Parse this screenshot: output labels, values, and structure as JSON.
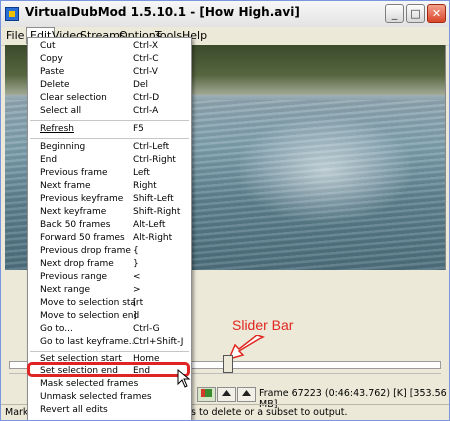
{
  "window": {
    "title": "VirtualDubMod 1.5.10.1 - [How High.avi]"
  },
  "window_buttons": {
    "minimize": "_",
    "maximize": "□",
    "close": "✕"
  },
  "menubar": {
    "items": [
      "File",
      "Edit",
      "Video",
      "Streams",
      "Options",
      "Tools",
      "Help"
    ],
    "active": "Edit"
  },
  "edit_menu": {
    "items": [
      {
        "label": "Cut",
        "accel": "Ctrl-X"
      },
      {
        "label": "Copy",
        "accel": "Ctrl-C"
      },
      {
        "label": "Paste",
        "accel": "Ctrl-V"
      },
      {
        "label": "Delete",
        "accel": "Del"
      },
      {
        "label": "Clear selection",
        "accel": "Ctrl-D"
      },
      {
        "label": "Select all",
        "accel": "Ctrl-A"
      },
      {
        "label": "Refresh",
        "accel": "F5"
      },
      {
        "label": "Beginning",
        "accel": "Ctrl-Left"
      },
      {
        "label": "End",
        "accel": "Ctrl-Right"
      },
      {
        "label": "Previous frame",
        "accel": "Left"
      },
      {
        "label": "Next frame",
        "accel": "Right"
      },
      {
        "label": "Previous keyframe",
        "accel": "Shift-Left"
      },
      {
        "label": "Next keyframe",
        "accel": "Shift-Right"
      },
      {
        "label": "Back 50 frames",
        "accel": "Alt-Left"
      },
      {
        "label": "Forward 50 frames",
        "accel": "Alt-Right"
      },
      {
        "label": "Previous drop frame",
        "accel": "{"
      },
      {
        "label": "Next drop frame",
        "accel": "}"
      },
      {
        "label": "Previous range",
        "accel": "<"
      },
      {
        "label": "Next range",
        "accel": ">"
      },
      {
        "label": "Move to selection start",
        "accel": "["
      },
      {
        "label": "Move to selection end",
        "accel": "]"
      },
      {
        "label": "Go to...",
        "accel": "Ctrl-G"
      },
      {
        "label": "Go to last keyframe...",
        "accel": "Ctrl+Shift-J"
      },
      {
        "label": "Set selection start",
        "accel": "Home"
      },
      {
        "label": "Set selection end",
        "accel": "End"
      },
      {
        "label": "Mask selected frames",
        "accel": ""
      },
      {
        "label": "Unmask selected frames",
        "accel": ""
      },
      {
        "label": "Revert all edits",
        "accel": ""
      }
    ],
    "highlighted": "Set selection end"
  },
  "annotation": {
    "text": "Slider Bar"
  },
  "frame_info": "Frame 67223 (0:46:43.762) [K] [353.56 MB]",
  "statusbar": {
    "left": "Mark",
    "right": "s to delete or a subset to output."
  },
  "colors": {
    "annotation": "#e0261f",
    "highlight_border": "#e02424"
  }
}
